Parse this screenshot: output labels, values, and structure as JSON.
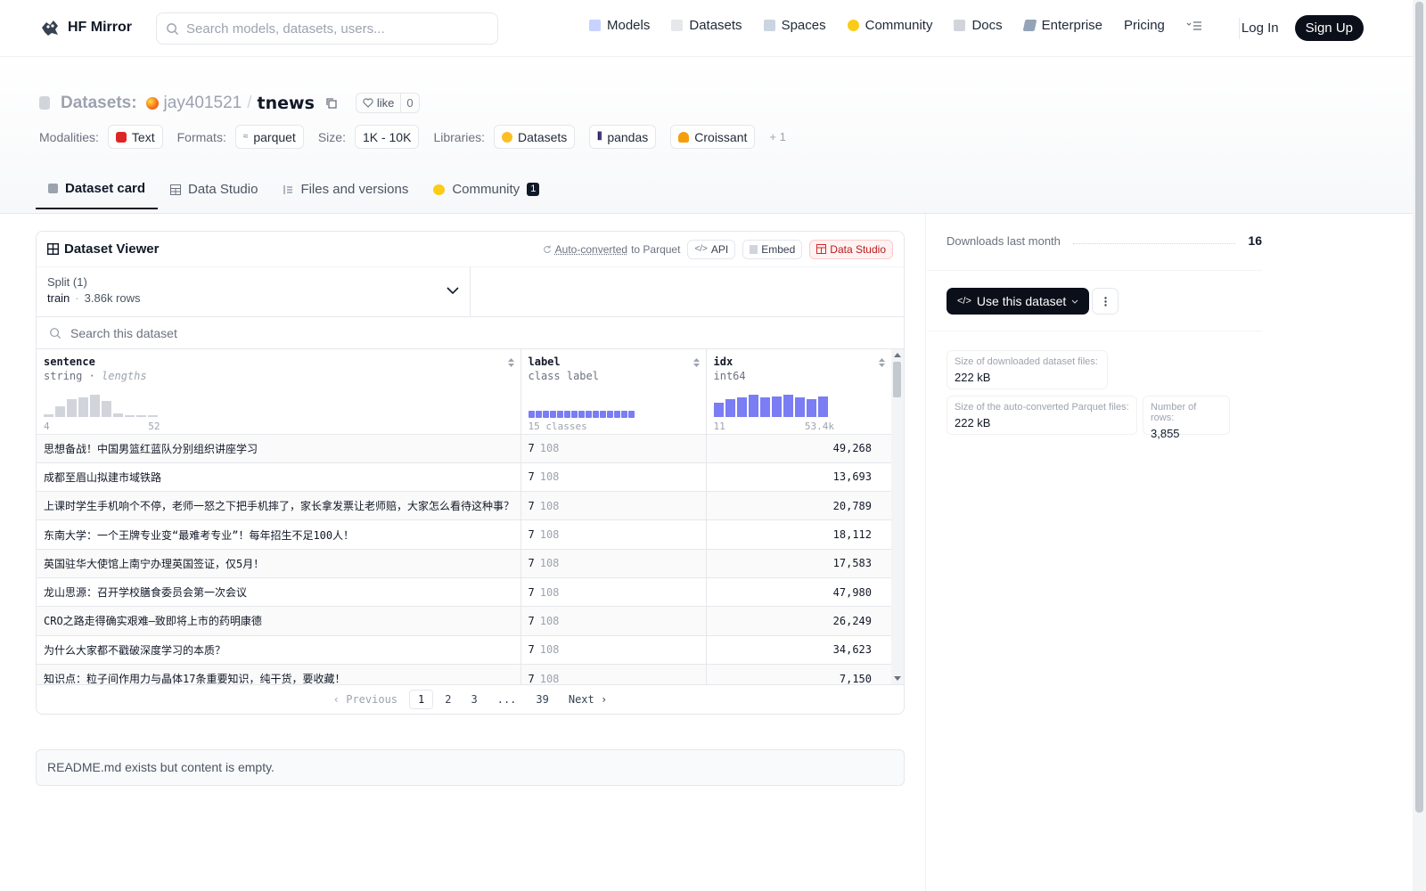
{
  "nav": {
    "brand": "HF Mirror",
    "search_placeholder": "Search models, datasets, users...",
    "links": [
      {
        "label": "Models",
        "icon": "models-icon",
        "color": "#c4b5fd"
      },
      {
        "label": "Datasets",
        "icon": "datasets-icon",
        "color": "#e5e7eb"
      },
      {
        "label": "Spaces",
        "icon": "spaces-icon",
        "color": "#cbd5e1"
      },
      {
        "label": "Community",
        "icon": "community-icon",
        "color": "#facc15"
      },
      {
        "label": "Docs",
        "icon": "docs-icon",
        "color": "#d1d5db"
      },
      {
        "label": "Enterprise",
        "icon": "enterprise-icon",
        "color": "#94a3b8"
      },
      {
        "label": "Pricing",
        "icon": "",
        "color": ""
      }
    ],
    "login": "Log In",
    "signup": "Sign Up"
  },
  "header": {
    "prefix": "Datasets:",
    "owner": "jay401521",
    "slash": "/",
    "name": "tnews",
    "like_label": "like",
    "like_count": "0"
  },
  "meta": {
    "modalities_label": "Modalities:",
    "modality": "Text",
    "formats_label": "Formats:",
    "format": "parquet",
    "size_label": "Size:",
    "size": "1K - 10K",
    "libraries_label": "Libraries:",
    "libraries": [
      "Datasets",
      "pandas",
      "Croissant"
    ],
    "more": "+ 1"
  },
  "tabs": [
    {
      "label": "Dataset card",
      "active": true
    },
    {
      "label": "Data Studio",
      "active": false
    },
    {
      "label": "Files and versions",
      "active": false
    },
    {
      "label": "Community",
      "active": false,
      "badge": "1"
    }
  ],
  "viewer": {
    "title": "Dataset Viewer",
    "auto_converted": "Auto-converted",
    "to_parquet": "to Parquet",
    "api": "API",
    "embed": "Embed",
    "data_studio": "Data Studio",
    "split_label": "Split (1)",
    "split_name": "train",
    "split_dot": "·",
    "split_rows": "3.86k rows",
    "search_placeholder": "Search this dataset",
    "columns": [
      {
        "name": "sentence",
        "type": "string",
        "type_extra": "lengths",
        "min": "4",
        "max": "52"
      },
      {
        "name": "label",
        "type": "class label",
        "classes": "15 classes"
      },
      {
        "name": "idx",
        "type": "int64",
        "min": "11",
        "max": "53.4k"
      }
    ],
    "sentence_hist": [
      0.1,
      0.45,
      0.75,
      0.85,
      0.95,
      0.7,
      0.15,
      0.05,
      0.05,
      0.05
    ],
    "idx_hist": [
      0.6,
      0.75,
      0.85,
      0.95,
      0.85,
      0.9,
      0.95,
      0.85,
      0.75,
      0.9
    ],
    "class_count": 15,
    "rows": [
      {
        "sentence": "思想备战！中国男篮红蓝队分别组织讲座学习",
        "label_id": "7",
        "label_name": "108",
        "idx": "49,268"
      },
      {
        "sentence": "成都至眉山拟建市域铁路",
        "label_id": "7",
        "label_name": "108",
        "idx": "13,693"
      },
      {
        "sentence": "上课时学生手机响个不停，老师一怒之下把手机摔了，家长拿发票让老师赔，大家怎么看待这种事？",
        "label_id": "7",
        "label_name": "108",
        "idx": "20,789"
      },
      {
        "sentence": "东南大学：一个王牌专业变“最难考专业”！每年招生不足100人！",
        "label_id": "7",
        "label_name": "108",
        "idx": "18,112"
      },
      {
        "sentence": "英国驻华大使馆上南宁办理英国签证，仅5月！",
        "label_id": "7",
        "label_name": "108",
        "idx": "17,583"
      },
      {
        "sentence": "龙山思源：召开学校膳食委员会第一次会议",
        "label_id": "7",
        "label_name": "108",
        "idx": "47,980"
      },
      {
        "sentence": "CRO之路走得确实艰难—致即将上市的药明康德",
        "label_id": "7",
        "label_name": "108",
        "idx": "26,249"
      },
      {
        "sentence": "为什么大家都不戳破深度学习的本质？",
        "label_id": "7",
        "label_name": "108",
        "idx": "34,623"
      },
      {
        "sentence": "知识点：粒子间作用力与晶体17条重要知识，纯干货，要收藏！",
        "label_id": "7",
        "label_name": "108",
        "idx": "7,150"
      }
    ],
    "pager": {
      "prev": "Previous",
      "pages": [
        "1",
        "2",
        "3",
        "...",
        "39"
      ],
      "next": "Next"
    }
  },
  "readme": "README.md exists but content is empty.",
  "sidebar": {
    "downloads_label": "Downloads last month",
    "downloads_value": "16",
    "use_button": "Use this dataset",
    "stats": [
      {
        "label": "Size of downloaded dataset files:",
        "value": "222 kB"
      },
      {
        "label": "Size of the auto-converted Parquet files:",
        "value": "222 kB"
      },
      {
        "label": "Number of rows:",
        "value": "3,855"
      }
    ]
  }
}
